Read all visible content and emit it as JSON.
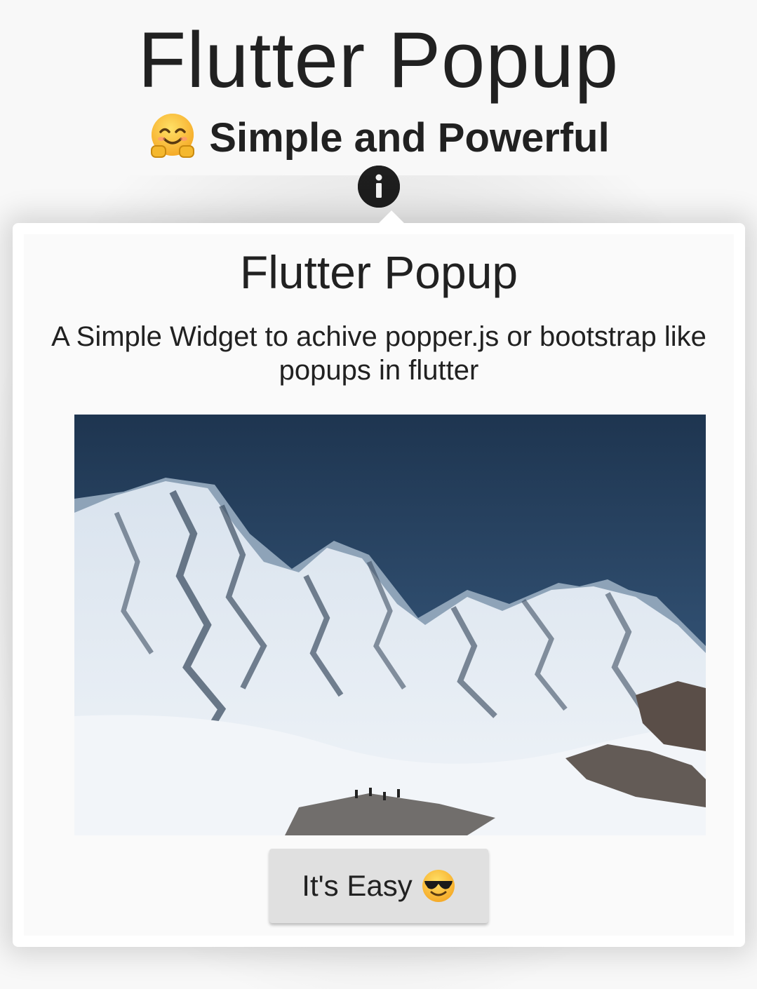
{
  "header": {
    "title": "Flutter Popup",
    "subtitle": "Simple and Powerful",
    "subtitle_icon": "hugging-face-emoji"
  },
  "info_button": {
    "icon": "info-icon"
  },
  "popup": {
    "title": "Flutter Popup",
    "description": "A Simple Widget to achive popper.js or bootstrap like popups in flutter",
    "image": "snowy-mountain-photo",
    "button": {
      "label": "It's Easy",
      "icon": "sunglasses-emoji"
    }
  },
  "colors": {
    "background": "#f8f8f8",
    "text": "#212121",
    "info_button": "#1f1f1f",
    "button_bg": "#e0e0e0",
    "popup_bg": "#ffffff"
  }
}
